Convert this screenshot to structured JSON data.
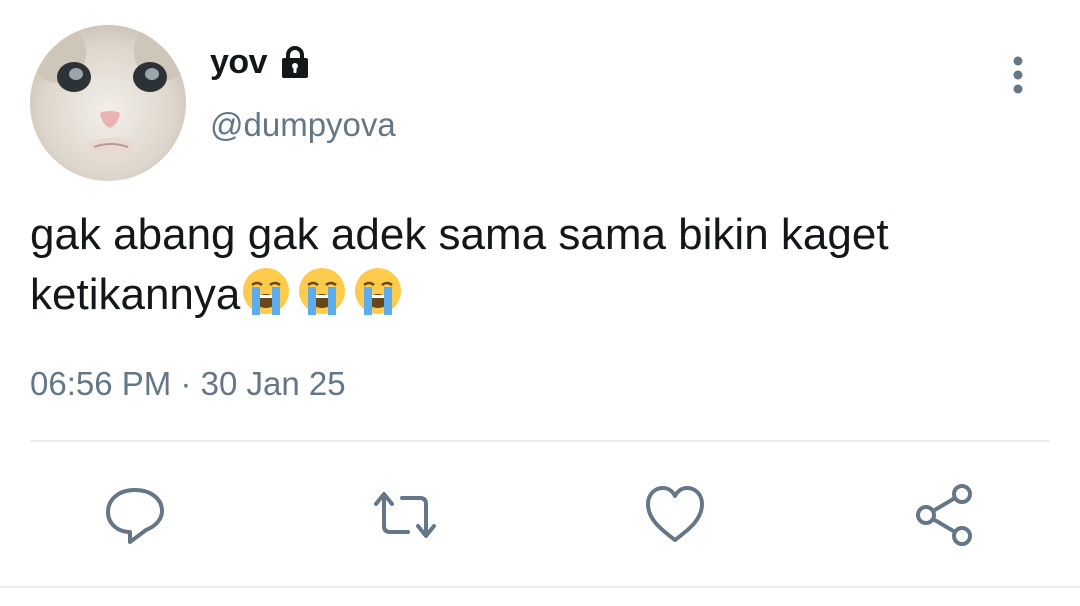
{
  "user": {
    "display_name": "yov",
    "handle": "@dumpyova",
    "protected_icon": "lock-icon",
    "avatar_description_icon": "cat-avatar"
  },
  "tweet": {
    "text": "gak abang gak adek sama sama bikin kaget ketikannya",
    "emojis": [
      "loudly-crying-face",
      "loudly-crying-face",
      "loudly-crying-face"
    ],
    "time": "06:56 PM",
    "separator": "·",
    "date": "30 Jan 25"
  },
  "actions": {
    "reply_icon": "reply-icon",
    "retweet_icon": "retweet-icon",
    "like_icon": "heart-icon",
    "share_icon": "share-icon",
    "more_icon": "more-vertical-icon"
  },
  "colors": {
    "text": "#14171a",
    "secondary": "#657786",
    "divider": "#e6ecf0"
  }
}
